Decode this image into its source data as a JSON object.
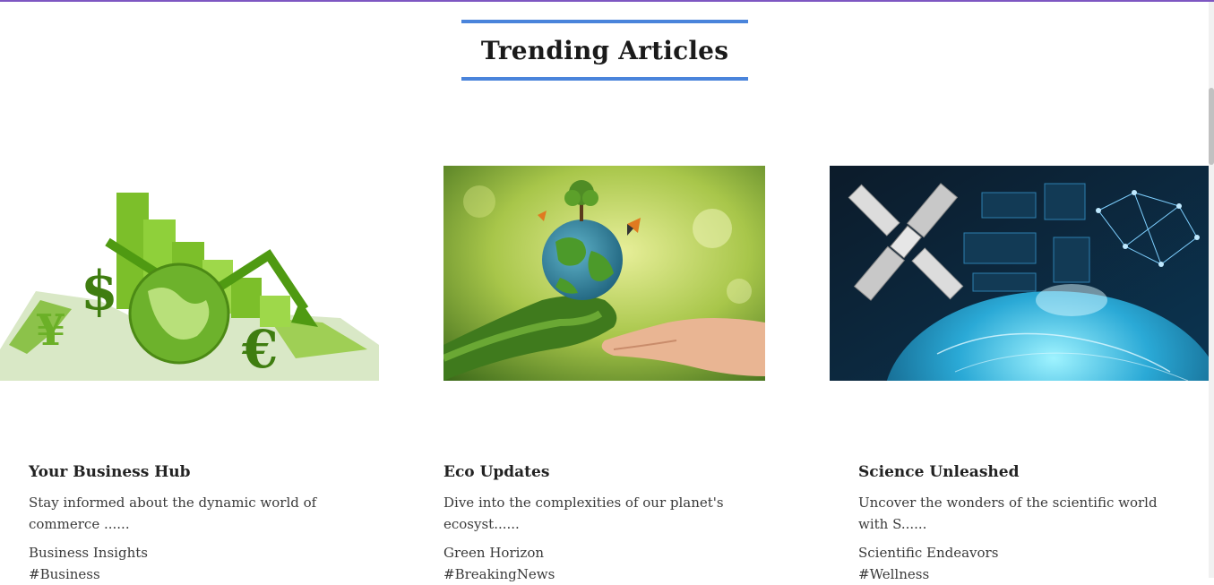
{
  "section": {
    "title": "Trending Articles"
  },
  "articles": [
    {
      "title": "Your Business Hub",
      "excerpt": "Stay informed about the dynamic world of commerce ......",
      "category": "Business Insights",
      "tag": "#Business",
      "image": "finance-growth-image"
    },
    {
      "title": "Eco Updates",
      "excerpt": "Dive into the complexities of our planet's ecosyst......",
      "category": "Green Horizon",
      "tag": "#BreakingNews",
      "image": "earth-in-hands-image"
    },
    {
      "title": "Science Unleashed",
      "excerpt": "Uncover the wonders of the scientific world with S......",
      "category": "Scientific Endeavors",
      "tag": "#Wellness",
      "image": "satellite-earth-image"
    }
  ],
  "colors": {
    "accent": "#4a84db",
    "top_bar": "#7e57c2",
    "text": "#3a3a3a"
  }
}
